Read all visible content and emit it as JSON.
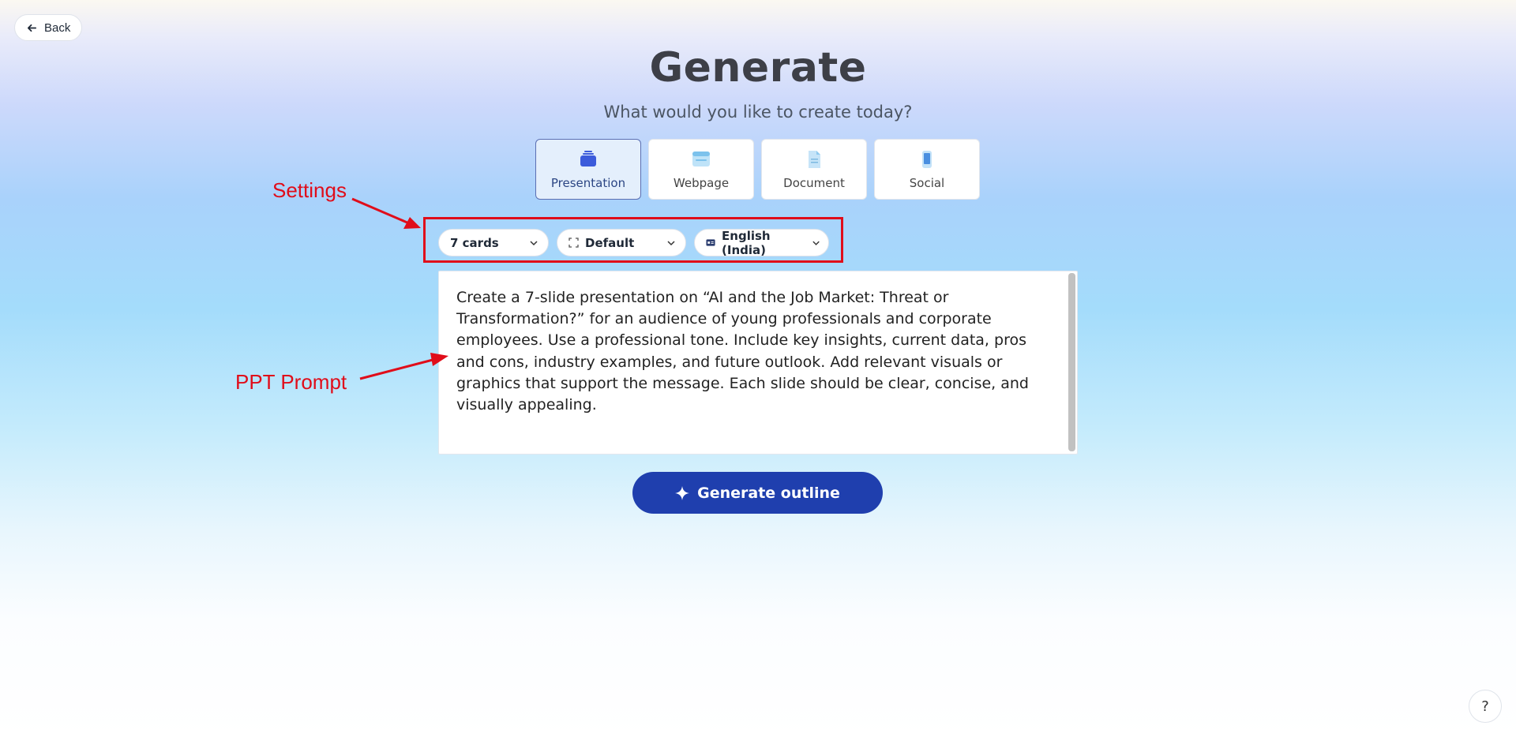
{
  "header": {
    "back_label": "Back",
    "title": "Generate",
    "subtitle": "What would you like to create today?"
  },
  "content_types": [
    {
      "label": "Presentation",
      "icon": "presentation-icon",
      "active": true
    },
    {
      "label": "Webpage",
      "icon": "webpage-icon",
      "active": false
    },
    {
      "label": "Document",
      "icon": "document-icon",
      "active": false
    },
    {
      "label": "Social",
      "icon": "phone-icon",
      "active": false
    }
  ],
  "settings": {
    "cards": "7 cards",
    "theme": "Default",
    "language": "English (India)"
  },
  "prompt": {
    "value": "Create a 7-slide presentation on “AI and the Job Market: Threat or Transformation?” for an audience of young professionals and corporate employees. Use a professional tone. Include key insights, current data, pros and cons, industry examples, and future outlook. Add relevant visuals or graphics that support the message. Each slide should be clear, concise, and visually appealing."
  },
  "actions": {
    "generate_label": "Generate outline",
    "help_label": "?"
  },
  "annotations": {
    "settings_label": "Settings",
    "prompt_label": "PPT Prompt",
    "color": "#e00d1a"
  },
  "colors": {
    "accent": "#1f3fae",
    "active_card_bg": "#e4effc"
  }
}
